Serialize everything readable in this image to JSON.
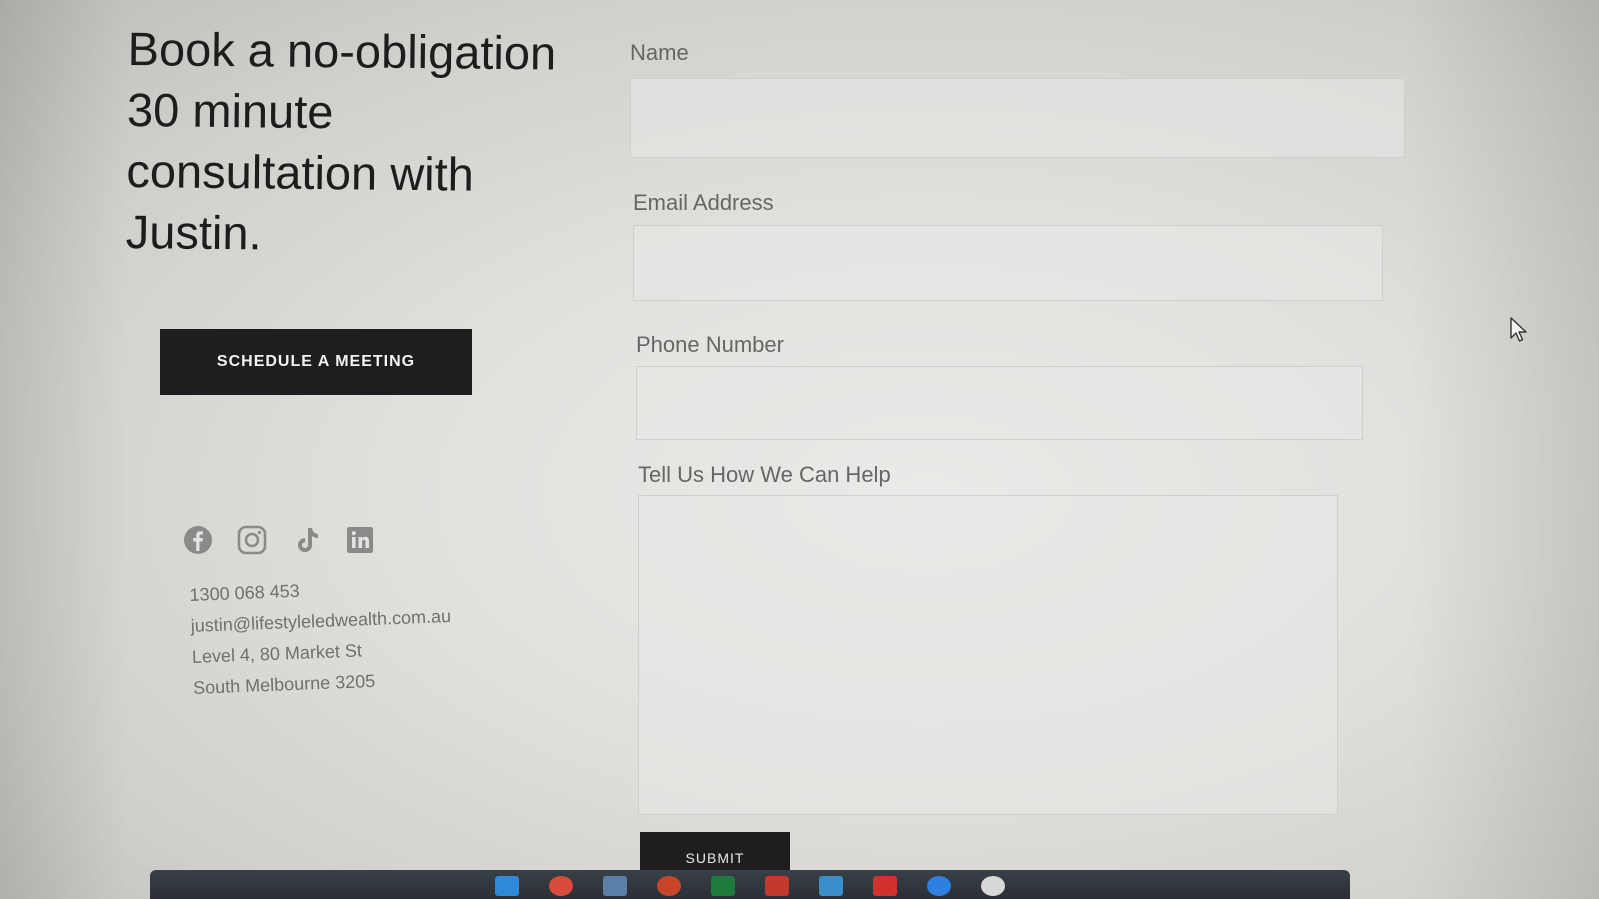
{
  "hero": {
    "headline": "Book a no-obligation 30 minute consultation with Justin.",
    "cta_label": "SCHEDULE A MEETING"
  },
  "social": [
    {
      "name": "facebook-icon"
    },
    {
      "name": "instagram-icon"
    },
    {
      "name": "tiktok-icon"
    },
    {
      "name": "linkedin-icon"
    }
  ],
  "contact": {
    "phone": "1300 068 453",
    "email": "justin@lifestyleledwealth.com.au",
    "address_line1": "Level 4, 80 Market St",
    "address_line2": "South Melbourne 3205"
  },
  "form": {
    "name_label": "Name",
    "name_value": "",
    "email_label": "Email Address",
    "email_value": "",
    "phone_label": "Phone Number",
    "phone_value": "",
    "message_label": "Tell Us How We Can Help",
    "message_value": "",
    "submit_label": "SUBMIT"
  },
  "taskbar": {
    "apps": [
      {
        "name": "file-explorer-icon",
        "color": "#2e8ad8"
      },
      {
        "name": "chrome-icon",
        "color": "#d94b3b"
      },
      {
        "name": "calculator-icon",
        "color": "#5a7fa8"
      },
      {
        "name": "powerpoint-icon",
        "color": "#c9452a"
      },
      {
        "name": "excel-icon",
        "color": "#1f7a3e"
      },
      {
        "name": "app-red-icon",
        "color": "#c0392b"
      },
      {
        "name": "photos-icon",
        "color": "#3a8ec9"
      },
      {
        "name": "acrobat-icon",
        "color": "#d0312d"
      },
      {
        "name": "zoom-icon",
        "color": "#2d7fe0"
      },
      {
        "name": "paint-icon",
        "color": "#d8d8d8"
      }
    ]
  },
  "colors": {
    "button_bg": "#1e1e20",
    "button_text": "#f2f2f2",
    "page_bg": "#e4e4e2",
    "label_text": "#666666"
  }
}
